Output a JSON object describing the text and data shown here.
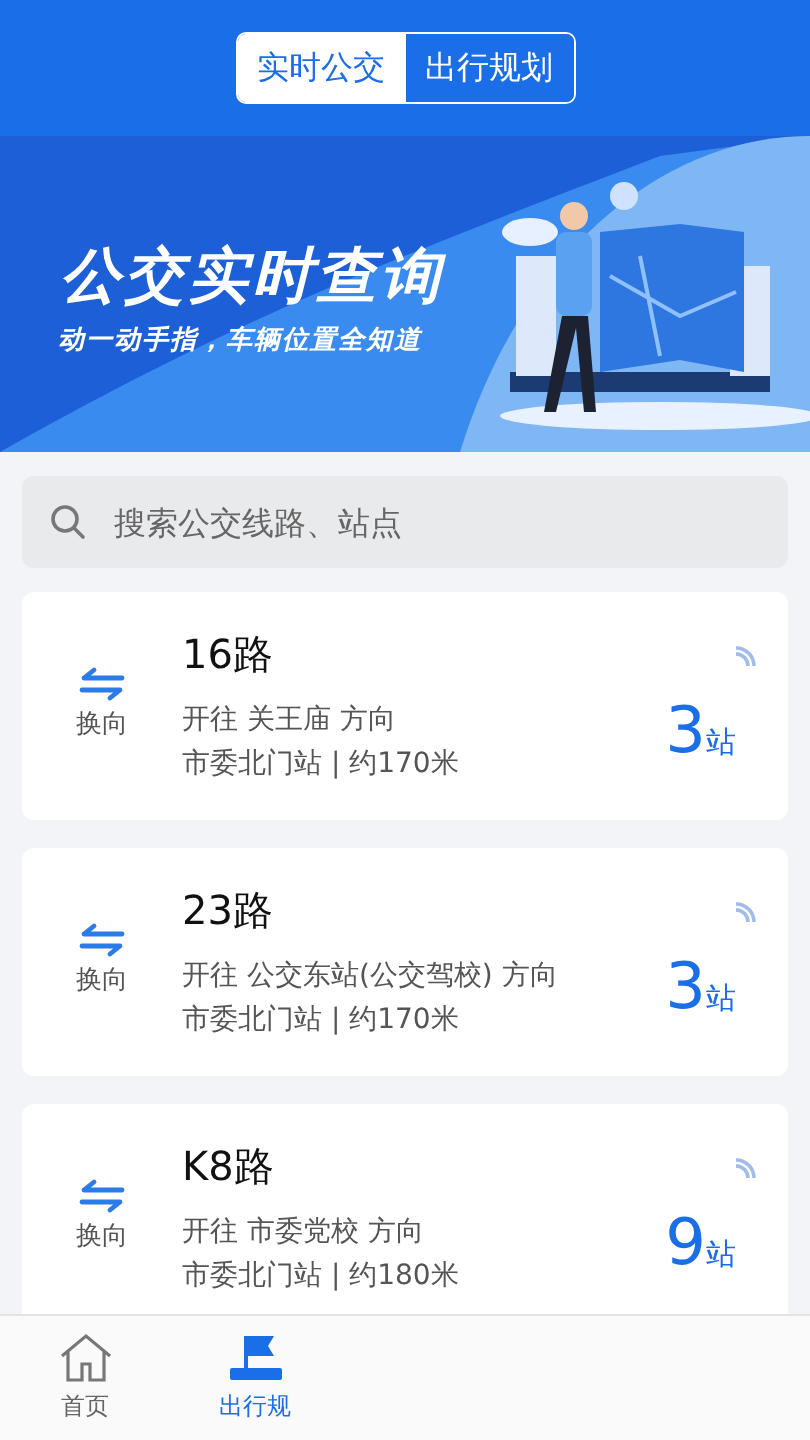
{
  "segments": [
    {
      "label": "实时公交",
      "selected": true
    },
    {
      "label": "出行规划",
      "selected": false
    }
  ],
  "banner": {
    "kind": "picture",
    "title": "公交实时查询",
    "subtitle": "动一动手指，车辆位置全知道"
  },
  "search": {
    "placeholder": "搜索公交线路、站点"
  },
  "routes": [
    {
      "swap_label": "换向",
      "name": "16路",
      "direction": "开往 关王庙 方向",
      "stop": "市委北门站 | 约170米",
      "count": "3",
      "unit": "站"
    },
    {
      "swap_label": "换向",
      "name": "23路",
      "direction": "开往 公交东站(公交驾校) 方向",
      "stop": "市委北门站 | 约170米",
      "count": "3",
      "unit": "站"
    },
    {
      "swap_label": "换向",
      "name": "K8路",
      "direction": "开往 市委党校 方向",
      "stop": "市委北门站 | 约180米",
      "count": "9",
      "unit": "站"
    }
  ],
  "bottom_nav": [
    {
      "label": "首页",
      "selected": false
    },
    {
      "label": "出行规",
      "selected": true
    }
  ]
}
